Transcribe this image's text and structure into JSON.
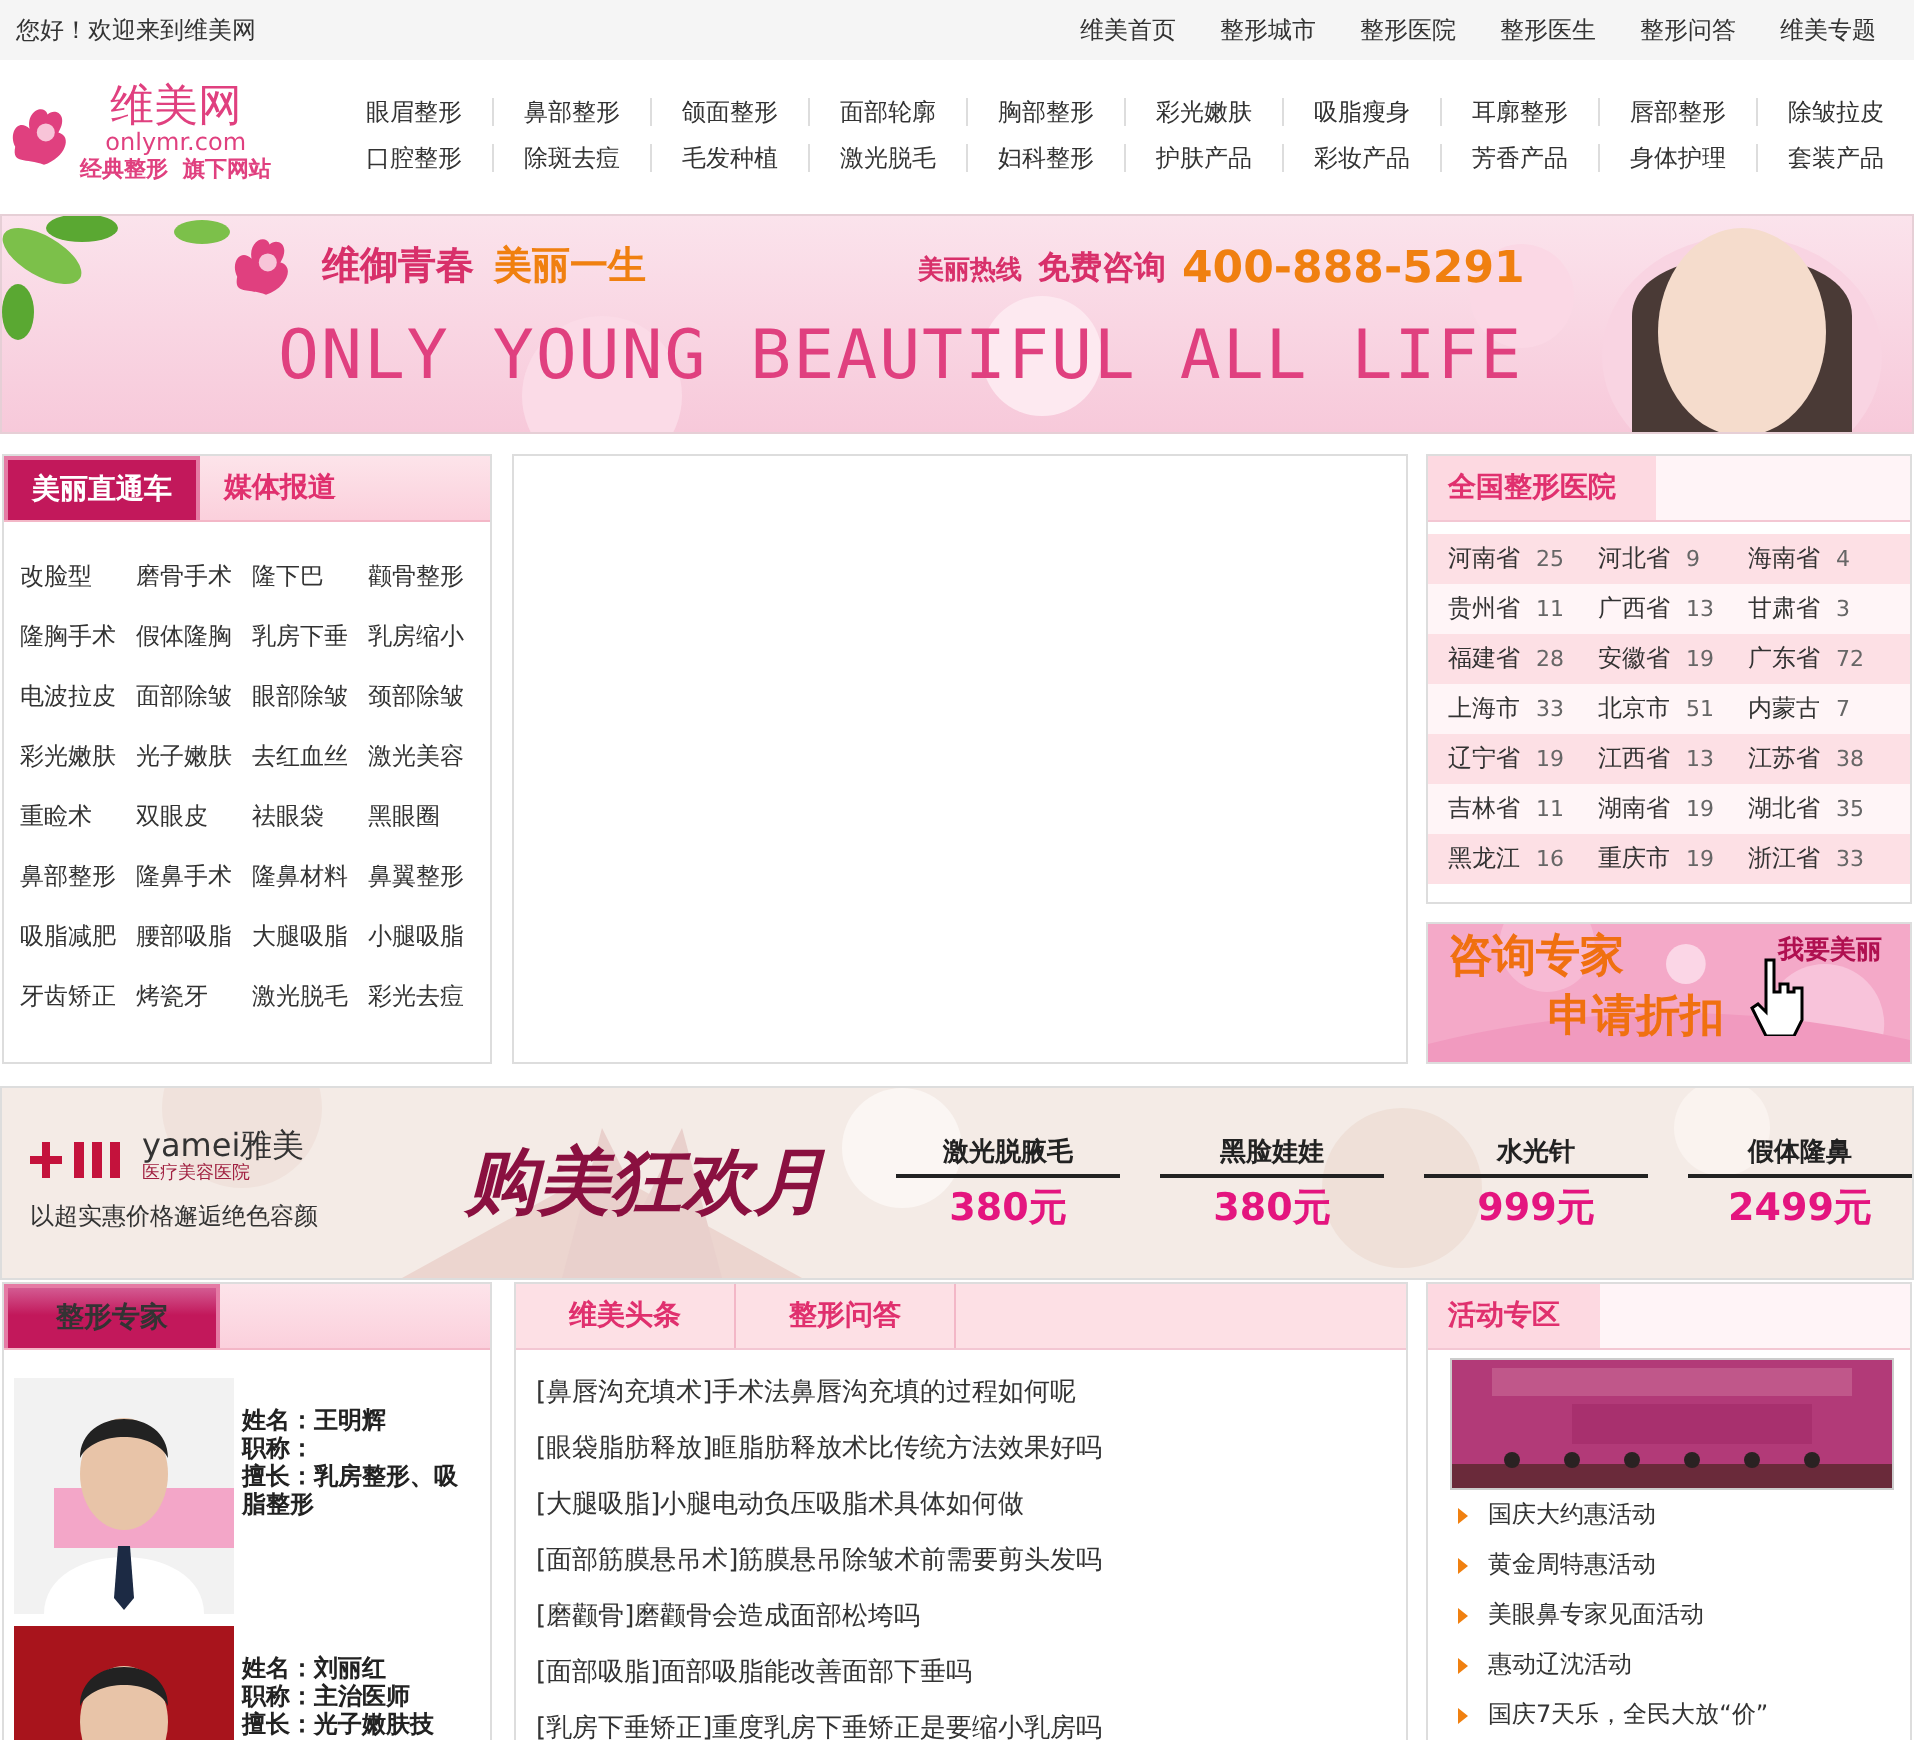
{
  "top_bar": {
    "greeting": "您好！欢迎来到维美网",
    "links": [
      "维美首页",
      "整形城市",
      "整形医院",
      "整形医生",
      "整形问答",
      "维美专题"
    ]
  },
  "header": {
    "logo": {
      "name": "维美网",
      "domain": "onlymr.com",
      "slogan": "经典整形  旗下网站"
    },
    "nav": [
      [
        "眼眉整形",
        "鼻部整形",
        "颌面整形",
        "面部轮廓",
        "胸部整形",
        "彩光嫩肤",
        "吸脂瘦身",
        "耳廓整形",
        "唇部整形",
        "除皱拉皮"
      ],
      [
        "口腔整形",
        "除斑去痘",
        "毛发种植",
        "激光脱毛",
        "妇科整形",
        "护肤产品",
        "彩妆产品",
        "芳香产品",
        "身体护理",
        "套装产品"
      ]
    ]
  },
  "banner": {
    "slogan_1": "维御青春",
    "slogan_2": "美丽一生",
    "hotline_label": "美丽热线",
    "consult": "免费咨询",
    "phone": "400-888-5291",
    "tagline": "ONLY YOUNG BEAUTIFUL ALL LIFE"
  },
  "topics": {
    "tabs": [
      {
        "label": "美丽直通车",
        "selected": true
      },
      {
        "label": "媒体报道",
        "selected": false
      }
    ],
    "items": [
      "改脸型",
      "磨骨手术",
      "隆下巴",
      "颧骨整形",
      "隆胸手术",
      "假体隆胸",
      "乳房下垂",
      "乳房缩小",
      "电波拉皮",
      "面部除皱",
      "眼部除皱",
      "颈部除皱",
      "彩光嫩肤",
      "光子嫩肤",
      "去红血丝",
      "激光美容",
      "重睑术",
      "双眼皮",
      "祛眼袋",
      "黑眼圈",
      "鼻部整形",
      "隆鼻手术",
      "隆鼻材料",
      "鼻翼整形",
      "吸脂减肥",
      "腰部吸脂",
      "大腿吸脂",
      "小腿吸脂",
      "牙齿矫正",
      "烤瓷牙",
      "激光脱毛",
      "彩光去痘"
    ]
  },
  "hospitals": {
    "title": "全国整形医院",
    "rows": [
      [
        {
          "name": "河南省",
          "count": "25"
        },
        {
          "name": "河北省",
          "count": "9"
        },
        {
          "name": "海南省",
          "count": "4"
        }
      ],
      [
        {
          "name": "贵州省",
          "count": "11"
        },
        {
          "name": "广西省",
          "count": "13"
        },
        {
          "name": "甘肃省",
          "count": "3"
        }
      ],
      [
        {
          "name": "福建省",
          "count": "28"
        },
        {
          "name": "安徽省",
          "count": "19"
        },
        {
          "name": "广东省",
          "count": "72"
        }
      ],
      [
        {
          "name": "上海市",
          "count": "33"
        },
        {
          "name": "北京市",
          "count": "51"
        },
        {
          "name": "内蒙古",
          "count": "7"
        }
      ],
      [
        {
          "name": "辽宁省",
          "count": "19"
        },
        {
          "name": "江西省",
          "count": "13"
        },
        {
          "name": "江苏省",
          "count": "38"
        }
      ],
      [
        {
          "name": "吉林省",
          "count": "11"
        },
        {
          "name": "湖南省",
          "count": "19"
        },
        {
          "name": "湖北省",
          "count": "35"
        }
      ],
      [
        {
          "name": "黑龙江",
          "count": "16"
        },
        {
          "name": "重庆市",
          "count": "19"
        },
        {
          "name": "浙江省",
          "count": "33"
        }
      ]
    ]
  },
  "promo": {
    "line_1": "咨询专家",
    "line_2": "申请折扣",
    "button": "我要美丽"
  },
  "ad": {
    "brand": "yamei雅美",
    "brand_sub": "医疗美容医院",
    "tagline": "以超实惠价格邂逅绝色容颜",
    "title": "购美狂欢月",
    "offers": [
      {
        "name": "激光脱腋毛",
        "price": "380元"
      },
      {
        "name": "黑脸娃娃",
        "price": "380元"
      },
      {
        "name": "水光针",
        "price": "999元"
      },
      {
        "name": "假体隆鼻",
        "price": "2499元"
      }
    ]
  },
  "experts": {
    "tab": {
      "label": "整形专家",
      "selected": true
    },
    "people": [
      {
        "lines": [
          "姓名：王明辉",
          "职称：",
          "擅长：乳房整形、吸脂整形"
        ]
      },
      {
        "lines": [
          "姓名：刘丽红",
          "职称：主治医师",
          "擅长：光子嫩肤技"
        ]
      }
    ]
  },
  "news": {
    "tabs": [
      "维美头条",
      "整形问答"
    ],
    "items": [
      {
        "tag": "[鼻唇沟充填术]",
        "title": "手术法鼻唇沟充填的过程如何呢"
      },
      {
        "tag": "[眼袋脂肪释放]",
        "title": "眶脂肪释放术比传统方法效果好吗"
      },
      {
        "tag": "[大腿吸脂]",
        "title": "小腿电动负压吸脂术具体如何做"
      },
      {
        "tag": "[面部筋膜悬吊术]",
        "title": "筋膜悬吊除皱术前需要剪头发吗"
      },
      {
        "tag": "[磨颧骨]",
        "title": "磨颧骨会造成面部松垮吗"
      },
      {
        "tag": "[面部吸脂]",
        "title": "面部吸脂能改善面部下垂吗"
      },
      {
        "tag": "[乳房下垂矫正]",
        "title": "重度乳房下垂矫正是要缩小乳房吗"
      }
    ]
  },
  "events": {
    "title": "活动专区",
    "items": [
      "国庆大约惠活动",
      "黄金周特惠活动",
      "美眼鼻专家见面活动",
      "惠动辽沈活动",
      "国庆7天乐，全民大放“价”"
    ]
  }
}
